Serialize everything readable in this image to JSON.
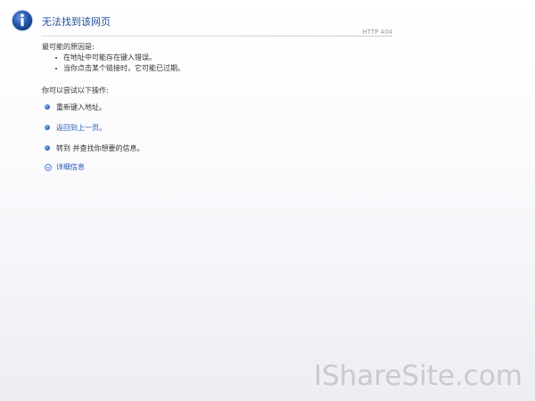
{
  "page": {
    "title": "无法找到该网页",
    "http_code": "HTTP 404"
  },
  "reasons": {
    "heading": "最可能的原因是:",
    "items": [
      "在地址中可能存在键入错误。",
      "当你点击某个链接时，它可能已过期。"
    ]
  },
  "actions": {
    "heading": "你可以尝试以下操作:",
    "items": [
      {
        "label": "重新键入地址。",
        "link": false
      },
      {
        "label": "返回到上一页。",
        "link": true
      },
      {
        "label": "转到  并查找你想要的信息。",
        "link": false
      }
    ]
  },
  "details": {
    "label": "详细信息"
  },
  "watermark": "IShareSite.com",
  "icons": {
    "info": "info-icon",
    "action_bullet": "bullet-icon",
    "details": "chevron-down-circle-icon"
  },
  "colors": {
    "title": "#1f4f9a",
    "link": "#1f55b4",
    "icon_blue": "#2d6bc1"
  }
}
